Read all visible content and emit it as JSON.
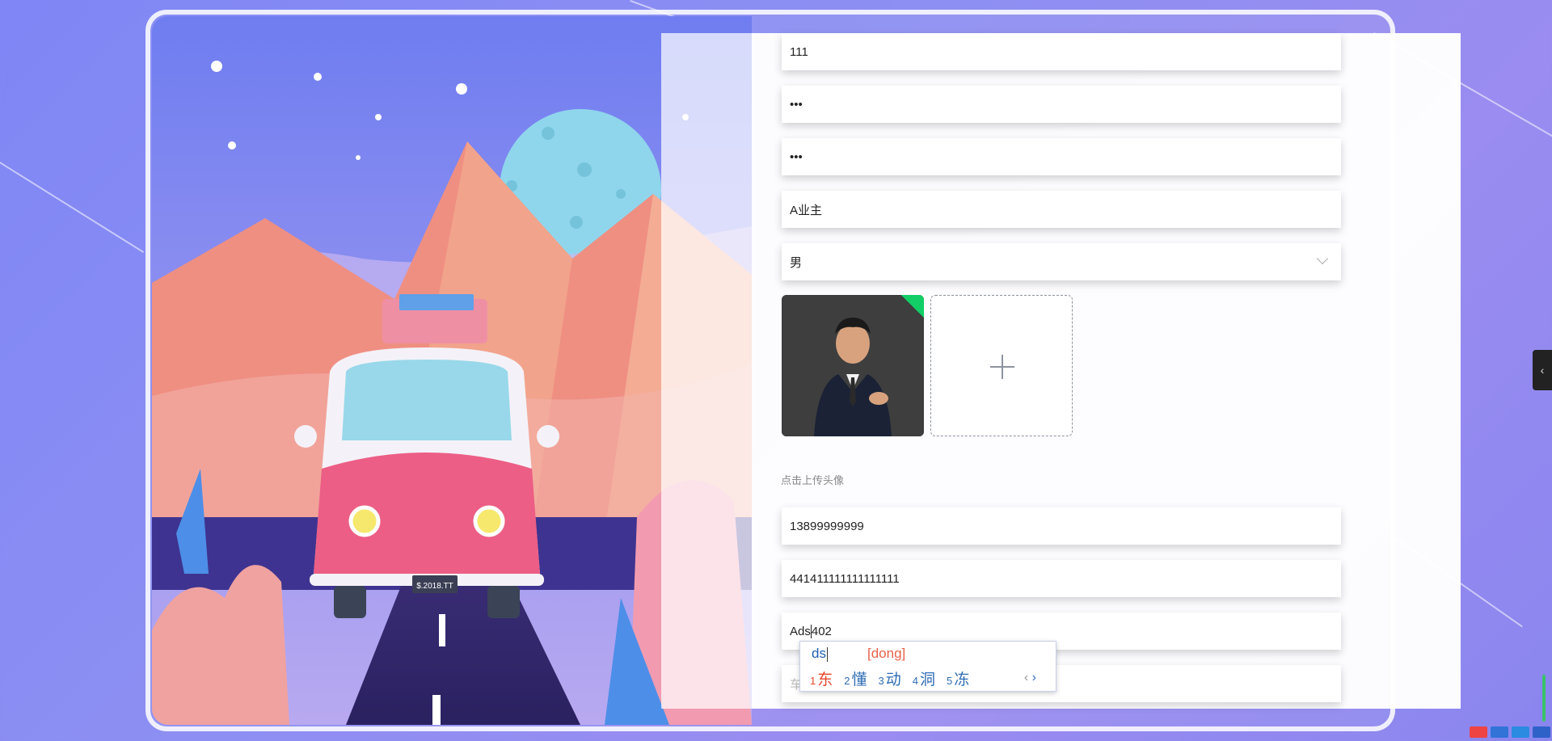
{
  "form": {
    "username": "111",
    "password": "•••",
    "confirm_password": "•••",
    "role": "A业主",
    "gender": "男",
    "upload_hint": "点击上传头像",
    "phone": "13899999999",
    "id_number": "441411111111111111",
    "address_before_cursor": "Ads",
    "address_after_cursor": "402",
    "next_placeholder": "车"
  },
  "ime": {
    "composition": "ds",
    "pinyin": "[dong]",
    "candidates": [
      {
        "num": "1",
        "char": "东"
      },
      {
        "num": "2",
        "char": "懂"
      },
      {
        "num": "3",
        "char": "动"
      },
      {
        "num": "4",
        "char": "洞"
      },
      {
        "num": "5",
        "char": "冻"
      }
    ],
    "prev": "‹",
    "next": "›"
  },
  "side_tab": "‹",
  "colors": {
    "background": "#8a8cf2",
    "avatar_badge": "#13ce66",
    "ime_first_candidate": "#e8462a",
    "ime_candidate": "#2f6db5"
  }
}
